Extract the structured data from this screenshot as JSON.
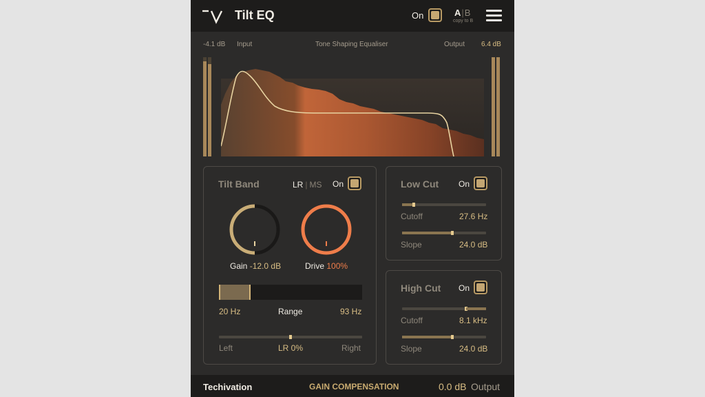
{
  "header": {
    "title": "Tilt EQ",
    "on_label": "On",
    "ab_a": "A",
    "ab_sep": "|",
    "ab_b": "B",
    "copy_label": "copy to B",
    "logo_icon": "techivation-logo-icon",
    "menu_icon": "hamburger-menu-icon"
  },
  "meters": {
    "input_value": "-4.1 dB",
    "input_label": "Input",
    "center_label": "Tone Shaping Equaliser",
    "output_label": "Output",
    "output_value": "6.4 dB",
    "input_levels": [
      0.96,
      0.93
    ],
    "output_levels": [
      1.0,
      1.0
    ]
  },
  "tilt": {
    "title": "Tilt Band",
    "lr": "LR",
    "sep": "|",
    "ms": "MS",
    "on_label": "On",
    "gain_label": "Gain",
    "gain_value": "-12.0 dB",
    "gain_fraction": 0.0,
    "drive_label": "Drive",
    "drive_value": "100%",
    "drive_fraction": 1.0,
    "range_low": "20 Hz",
    "range_label": "Range",
    "range_high": "93 Hz",
    "range_start_fraction": 0.0,
    "range_end_fraction": 0.22,
    "pan_left": "Left",
    "pan_value": "LR 0%",
    "pan_right": "Right",
    "pan_fraction": 0.5
  },
  "low_cut": {
    "title": "Low Cut",
    "on_label": "On",
    "cutoff_label": "Cutoff",
    "cutoff_value": "27.6 Hz",
    "cutoff_fraction": 0.14,
    "slope_label": "Slope",
    "slope_value": "24.0 dB",
    "slope_fraction": 0.6
  },
  "high_cut": {
    "title": "High Cut",
    "on_label": "On",
    "cutoff_label": "Cutoff",
    "cutoff_value": "8.1 kHz",
    "cutoff_fraction": 0.76,
    "slope_label": "Slope",
    "slope_value": "24.0 dB",
    "slope_fraction": 0.6
  },
  "footer": {
    "brand": "Techivation",
    "gain_compensation": "GAIN COMPENSATION",
    "output_value": "0.0 dB",
    "output_label": "Output"
  },
  "colors": {
    "accent_gold": "#d8bd84",
    "drive_orange": "#ef7d4a",
    "background": "#2c2b2a"
  }
}
